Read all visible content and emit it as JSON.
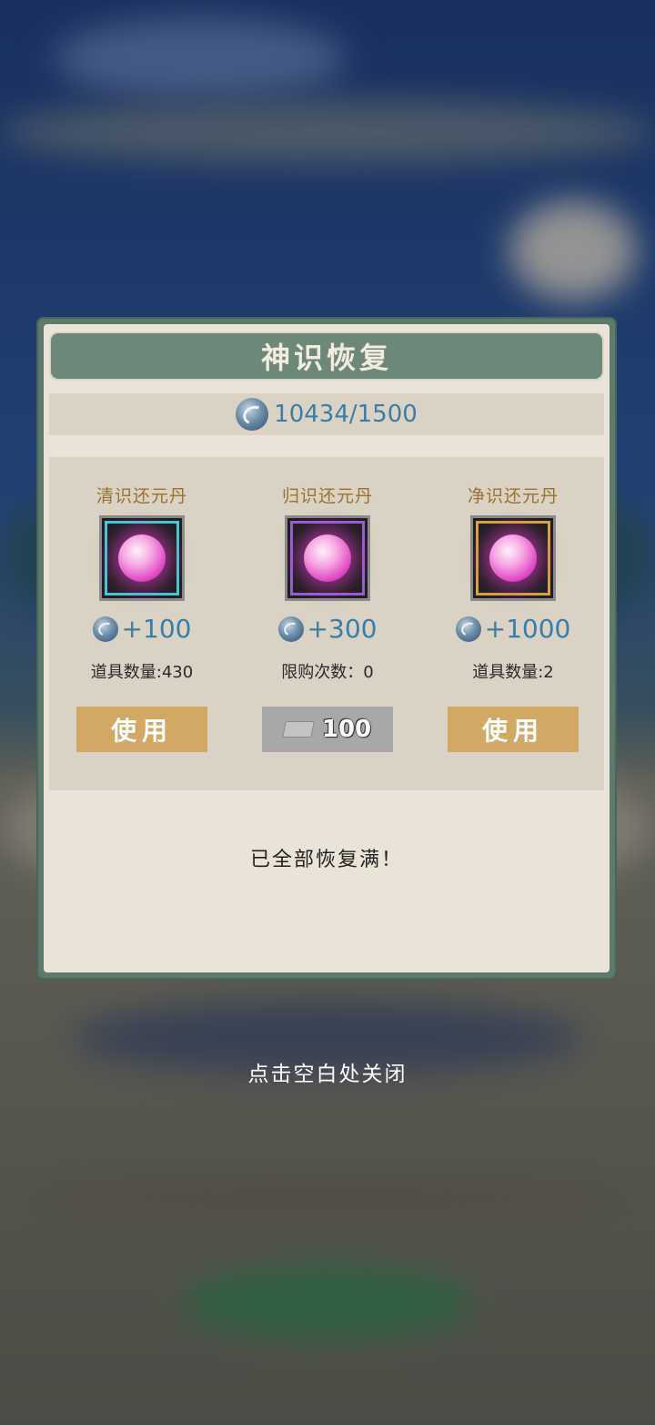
{
  "dialog": {
    "title": "神识恢复",
    "counter": "10434/1500"
  },
  "items": [
    {
      "name": "清识还元丹",
      "frame_color": "#45c7de",
      "amount": "+100",
      "info": "道具数量:430",
      "action": {
        "type": "use",
        "label": "使用"
      }
    },
    {
      "name": "归识还元丹",
      "frame_color": "#9a5bd6",
      "amount": "+300",
      "info": "限购次数：0",
      "action": {
        "type": "buy",
        "price": "100",
        "currency_icon": "ticket-icon"
      }
    },
    {
      "name": "净识还元丹",
      "frame_color": "#d9a23f",
      "amount": "+1000",
      "info": "道具数量:2",
      "action": {
        "type": "use",
        "label": "使用"
      }
    }
  ],
  "status_message": "已全部恢复满！",
  "close_hint": "点击空白处关闭",
  "colors": {
    "title_bar": "#6d8879",
    "panel": "#d9d2c5",
    "use_button": "#d2a865",
    "buy_button": "#a8a8a8",
    "value_text": "#3a7ea6",
    "item_name": "#9a7230"
  }
}
